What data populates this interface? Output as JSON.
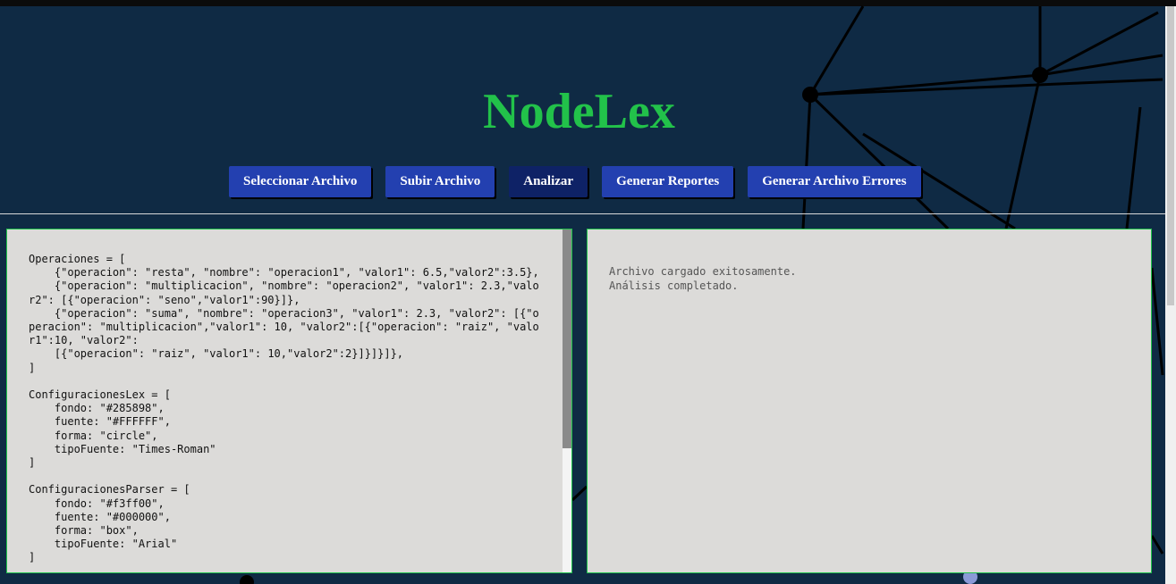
{
  "app": {
    "title": "NodeLex"
  },
  "toolbar": {
    "select_file": "Seleccionar Archivo",
    "upload_file": "Subir Archivo",
    "analyze": "Analizar",
    "generate_reports": "Generar Reportes",
    "generate_errors_file": "Generar Archivo Errores"
  },
  "editor": {
    "content": "Operaciones = [\n    {\"operacion\": \"resta\", \"nombre\": \"operacion1\", \"valor1\": 6.5,\"valor2\":3.5},\n    {\"operacion\": \"multiplicacion\", \"nombre\": \"operacion2\", \"valor1\": 2.3,\"valor2\": [{\"operacion\": \"seno\",\"valor1\":90}]},\n    {\"operacion\": \"suma\", \"nombre\": \"operacion3\", \"valor1\": 2.3, \"valor2\": [{\"operacion\": \"multiplicacion\",\"valor1\": 10, \"valor2\":[{\"operacion\": \"raiz\", \"valor1\":10, \"valor2\":\n    [{\"operacion\": \"raiz\", \"valor1\": 10,\"valor2\":2}]}]}]},\n]\n\nConfiguracionesLex = [\n    fondo: \"#285898\",\n    fuente: \"#FFFFFF\",\n    forma: \"circle\",\n    tipoFuente: \"Times-Roman\"\n]\n\nConfiguracionesParser = [\n    fondo: \"#f3ff00\",\n    fuente: \"#000000\",\n    forma: \"box\",\n    tipoFuente: \"Arial\"\n]"
  },
  "output": {
    "content": "Archivo cargado exitosamente.\nAnálisis completado."
  },
  "colors": {
    "background": "#0f2a44",
    "title": "#22c24a",
    "button": "#2340b0",
    "button_active": "#0e2266",
    "panel": "#dcdbd9",
    "panel_border": "#1fc24a"
  }
}
